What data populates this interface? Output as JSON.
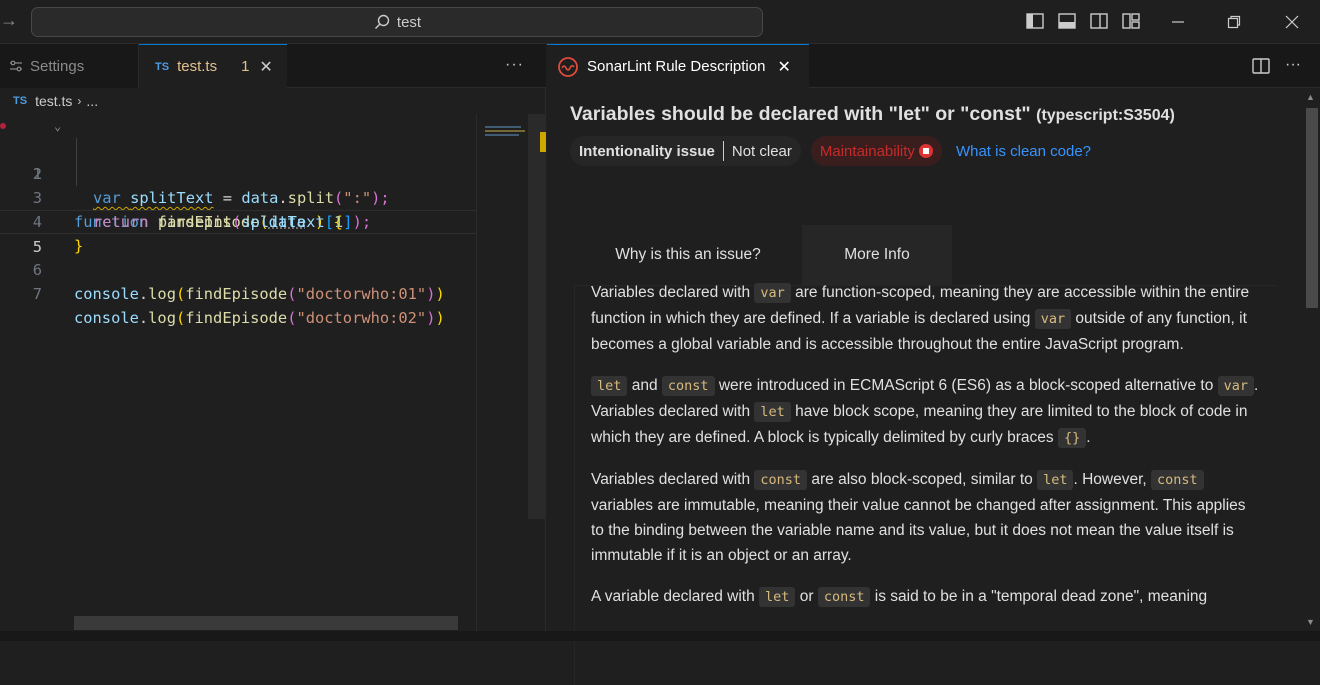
{
  "titlebar": {
    "search_text": "test"
  },
  "editor": {
    "tabs": [
      {
        "label": "Settings"
      },
      {
        "label": "test.ts",
        "badge": "TS",
        "problems": "1"
      }
    ],
    "breadcrumb": {
      "badge": "TS",
      "file": "test.ts",
      "rest": "..."
    },
    "line_numbers": [
      "1",
      "2",
      "3",
      "4",
      "5",
      "6",
      "7"
    ],
    "code": {
      "l1": {
        "kw": "function",
        "fn": "findEpisode",
        "open": "(",
        "param": "data",
        "close": " )",
        "brace": " {"
      },
      "l2": {
        "kw": "var",
        "name": "splitText",
        "eq": " = ",
        "obj": "data",
        "dot": ".",
        "meth": "split",
        "p1": "(",
        "str": "\":\"",
        "p2": ");"
      },
      "l3": {
        "kw": "return",
        "fn": "parseInt",
        "p1": "(",
        "arg": "splitText",
        "b1": "[",
        "num": "1",
        "b2": "]",
        "p2": ");"
      },
      "l4": {
        "brace": "}"
      },
      "l6": {
        "obj": "console",
        "dot": ".",
        "meth": "log",
        "p1": "(",
        "fn": "findEpisode",
        "p2": "(",
        "str": "\"doctorwho:01\"",
        "p3": ")",
        "p4": ")"
      },
      "l7": {
        "obj": "console",
        "dot": ".",
        "meth": "log",
        "p1": "(",
        "fn": "findEpisode",
        "p2": "(",
        "str": "\"doctorwho:02\"",
        "p3": ")",
        "p4": ")"
      }
    }
  },
  "panel": {
    "tab_label": "SonarLint Rule Description",
    "title": "Variables should be declared with \"let\" or \"const\"",
    "rule_key": "(typescript:S3504)",
    "attribute_category": "Intentionality issue",
    "attribute_value": "Not clear",
    "impact": "Maintainability",
    "clean_code_link": "What is clean code?",
    "tabs": [
      "Why is this an issue?",
      "More Info"
    ],
    "p1": {
      "a": "Variables declared with ",
      "c1": "var",
      "b": " are function-scoped, meaning they are accessible within the entire function in which they are defined. If a variable is declared using ",
      "c2": "var",
      "d": " outside of any function, it becomes a global variable and is accessible throughout the entire JavaScript program."
    },
    "p2": {
      "c1": "let",
      "a": " and ",
      "c2": "const",
      "b": " were introduced in ECMAScript 6 (ES6) as a block-scoped alternative to ",
      "c3": "var",
      "d": ". Variables declared with ",
      "c4": "let",
      "e": " have block scope, meaning they are limited to the block of code in which they are defined. A block is typically delimited by curly braces ",
      "c5": "{}",
      "f": "."
    },
    "p3": {
      "a": "Variables declared with ",
      "c1": "const",
      "b": " are also block-scoped, similar to ",
      "c2": "let",
      "d": ". However, ",
      "c3": "const",
      "e": " variables are immutable, meaning their value cannot be changed after assignment. This applies to the binding between the variable name and its value, but it does not mean the value itself is immutable if it is an object or an array."
    },
    "p4": {
      "a": "A variable declared with ",
      "c1": "let",
      "b": " or ",
      "c2": "const",
      "d": " is said to be in a \"temporal dead zone\", meaning"
    }
  },
  "colors": {
    "accent": "#0078d4",
    "impact_high": "#c52b2b",
    "link": "#3794ff",
    "modified": "#e2c08d"
  }
}
